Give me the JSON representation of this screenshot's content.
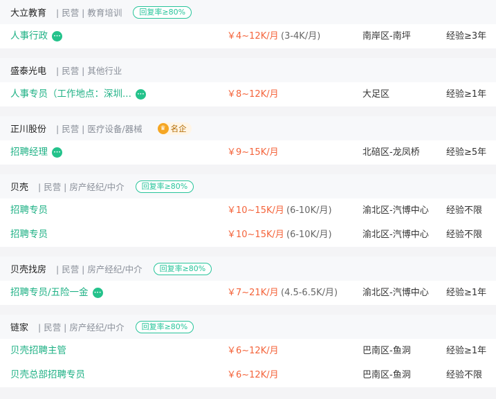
{
  "companies": [
    {
      "name": "大立教育",
      "meta": "| 民营 | 教育培训",
      "badge": "回复率≥80%",
      "jobs": [
        {
          "title": "人事行政",
          "chat": true,
          "salary": "￥4~12K/月",
          "salary_sub": "(3-4K/月)",
          "location": "南岸区-南坪",
          "experience": "经验≥3年"
        }
      ]
    },
    {
      "name": "盛泰光电",
      "meta": "| 民营 | 其他行业",
      "jobs": [
        {
          "title": "人事专员（工作地点：深圳...",
          "chat": true,
          "salary": "￥8~12K/月",
          "salary_sub": "",
          "location": "大足区",
          "experience": "经验≥1年"
        }
      ]
    },
    {
      "name": "正川股份",
      "meta": "| 民营 | 医疗设备/器械",
      "famous": "名企",
      "jobs": [
        {
          "title": "招聘经理",
          "chat": true,
          "salary": "￥9~15K/月",
          "salary_sub": "",
          "location": "北碚区-龙凤桥",
          "experience": "经验≥5年"
        }
      ]
    },
    {
      "name": "贝壳",
      "meta": "| 民营 | 房产经纪/中介",
      "badge": "回复率≥80%",
      "jobs": [
        {
          "title": "招聘专员",
          "chat": false,
          "salary": "￥10~15K/月",
          "salary_sub": "(6-10K/月)",
          "location": "渝北区-汽博中心",
          "experience": "经验不限"
        },
        {
          "title": "招聘专员",
          "chat": false,
          "salary": "￥10~15K/月",
          "salary_sub": "(6-10K/月)",
          "location": "渝北区-汽博中心",
          "experience": "经验不限"
        }
      ]
    },
    {
      "name": "贝壳找房",
      "meta": "| 民营 | 房产经纪/中介",
      "badge": "回复率≥80%",
      "jobs": [
        {
          "title": "招聘专员/五险一金",
          "chat": true,
          "salary": "￥7~21K/月",
          "salary_sub": "(4.5-6.5K/月)",
          "location": "渝北区-汽博中心",
          "experience": "经验≥1年"
        }
      ]
    },
    {
      "name": "链家",
      "meta": "| 民营 | 房产经纪/中介",
      "badge": "回复率≥80%",
      "jobs": [
        {
          "title": "贝壳招聘主管",
          "chat": false,
          "salary": "￥6~12K/月",
          "salary_sub": "",
          "location": "巴南区-鱼洞",
          "experience": "经验≥1年"
        },
        {
          "title": "贝壳总部招聘专员",
          "chat": false,
          "salary": "￥6~12K/月",
          "salary_sub": "",
          "location": "巴南区-鱼洞",
          "experience": "经验不限"
        }
      ]
    }
  ]
}
